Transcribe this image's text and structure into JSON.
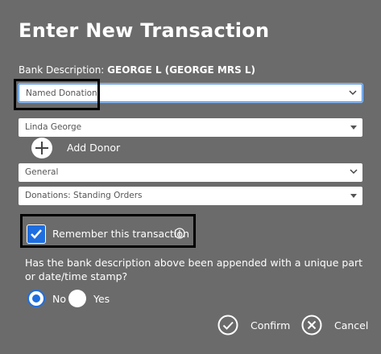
{
  "dialog": {
    "title": "Enter New Transaction",
    "bank_description_label": "Bank Description:",
    "bank_description_value": "GEORGE L (GEORGE MRS L)"
  },
  "fields": {
    "type_select": "Named Donation",
    "donor_select": "Linda George",
    "fund_select": "General",
    "category_select": "Donations: Standing Orders"
  },
  "add_donor_label": "Add Donor",
  "remember": {
    "label": "Remember this transaction",
    "checked": true
  },
  "question": "Has the bank description above been appended with a unique part or date/time stamp?",
  "radios": {
    "no_label": "No",
    "yes_label": "Yes",
    "selected": "No"
  },
  "actions": {
    "confirm_label": "Confirm",
    "cancel_label": "Cancel"
  },
  "colors": {
    "background": "#6b6b6b",
    "accent": "#1e6ee0"
  }
}
